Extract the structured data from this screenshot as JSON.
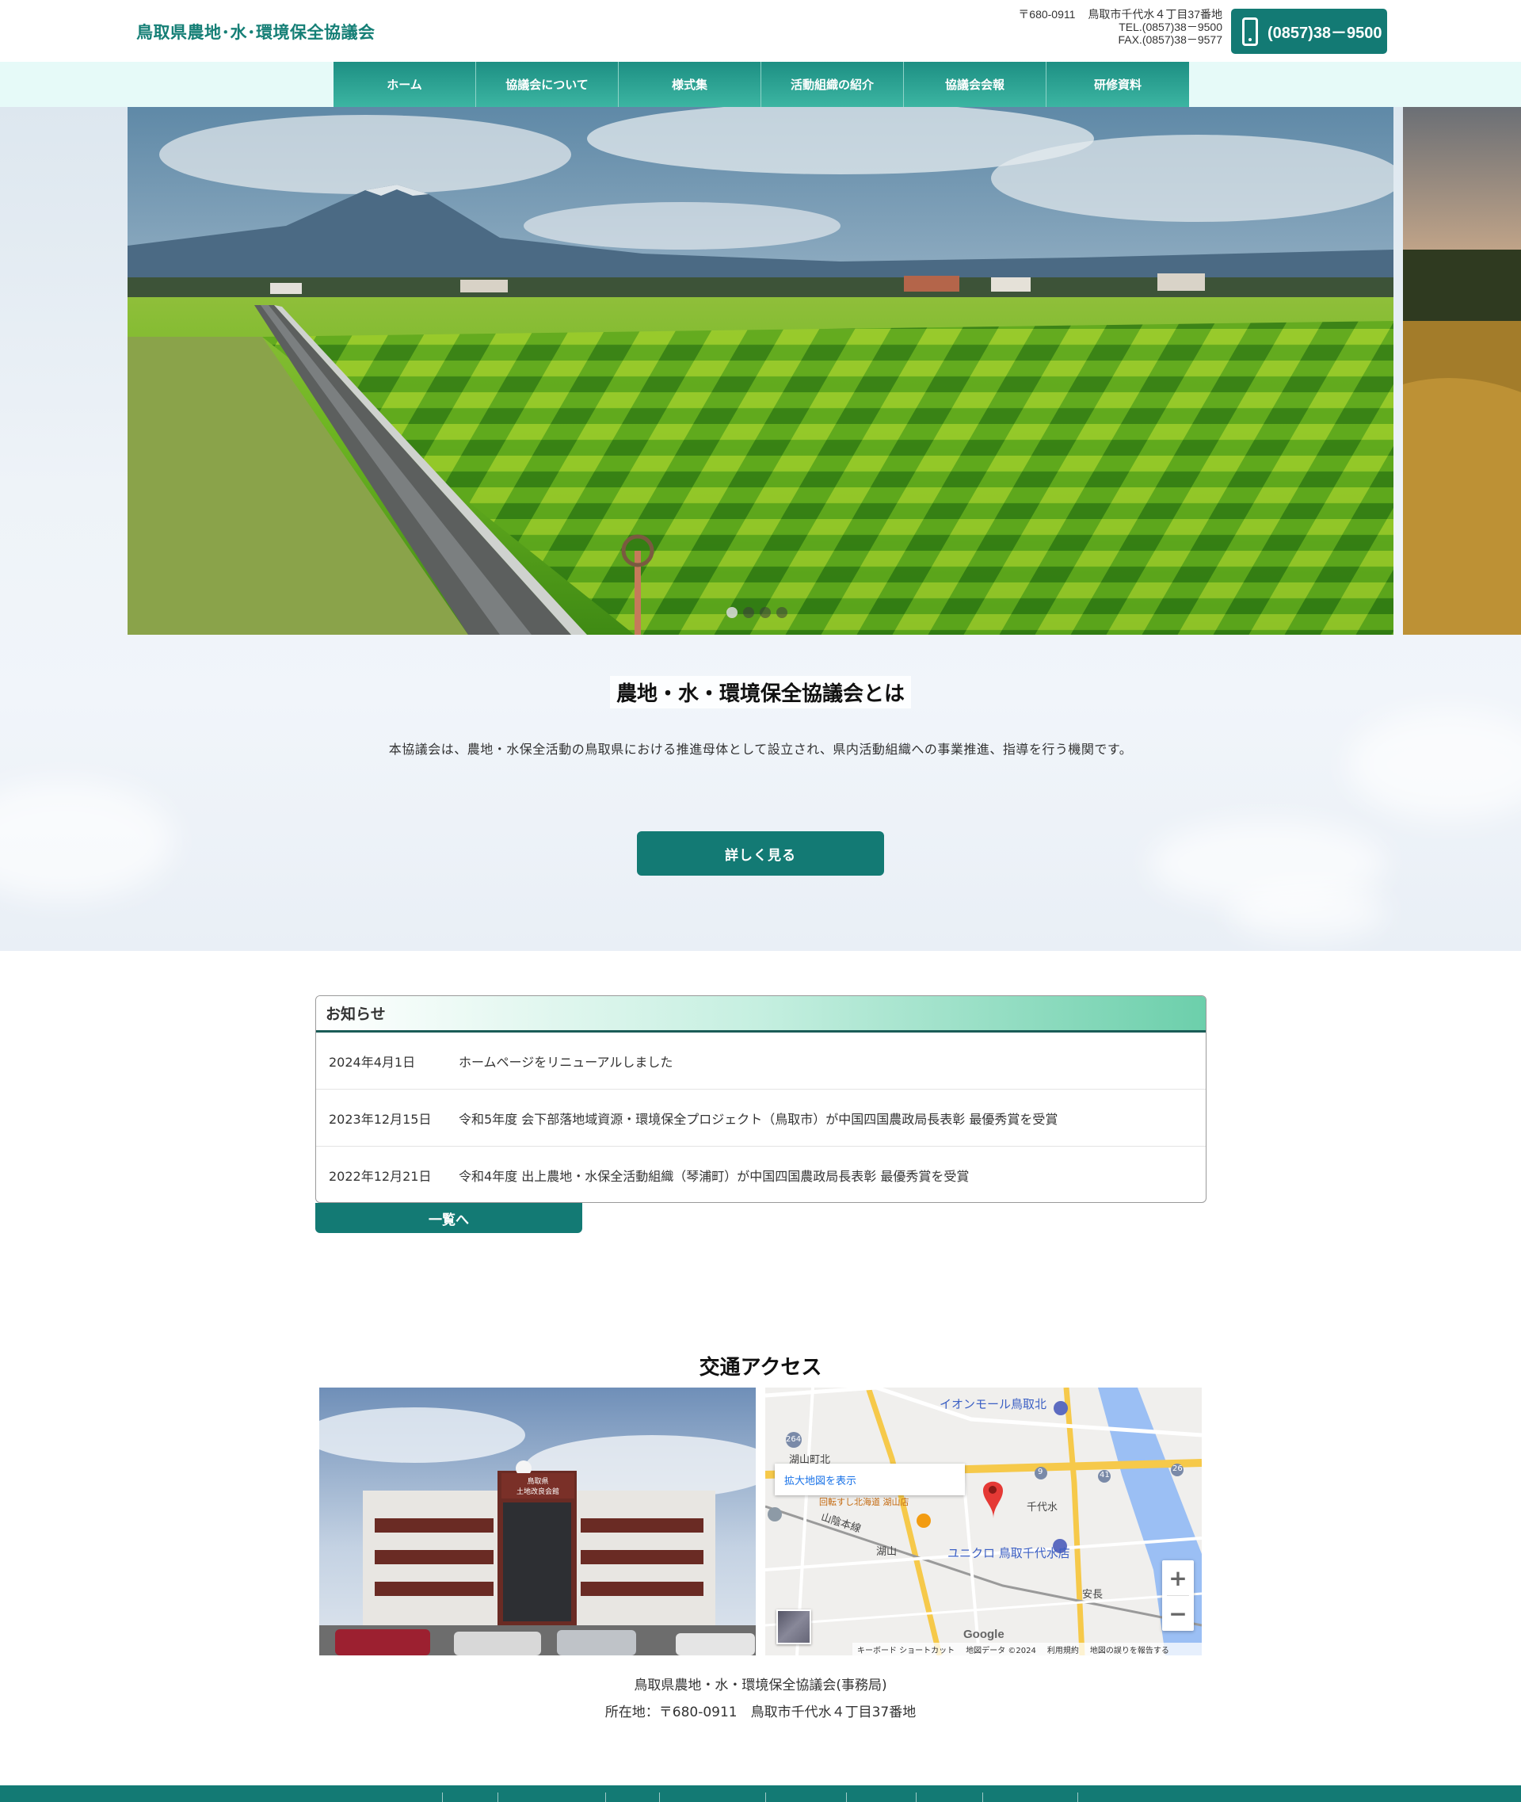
{
  "header": {
    "site_title": "鳥取県農地･水･環境保全協議会",
    "postal": "〒680-0911",
    "address": "鳥取市千代水４丁目37番地",
    "tel": "TEL.(0857)38－9500",
    "fax": "FAX.(0857)38－9577",
    "phone_button": "(0857)38－9500",
    "phone_icon": "smartphone-icon"
  },
  "nav": {
    "items": [
      {
        "label": "ホーム"
      },
      {
        "label": "協議会について"
      },
      {
        "label": "様式集"
      },
      {
        "label": "活動組織の紹介"
      },
      {
        "label": "協議会会報"
      },
      {
        "label": "研修資料"
      }
    ]
  },
  "slider": {
    "slide_count": 4,
    "active_index": 0
  },
  "about": {
    "title": "農地・水・環境保全協議会とは",
    "text": "本協議会は、農地・水保全活動の鳥取県における推進母体として設立され、県内活動組織への事業推進、指導を行う機関です。",
    "more_button": "詳しく見る"
  },
  "news": {
    "heading": "お知らせ",
    "items": [
      {
        "date": "2024年4月1日",
        "title": "ホームページをリニューアルしました"
      },
      {
        "date": "2023年12月15日",
        "title": "令和5年度 会下部落地域資源・環境保全プロジェクト（鳥取市）が中国四国農政局長表彰 最優秀賞を受賞"
      },
      {
        "date": "2022年12月21日",
        "title": "令和4年度 出上農地・水保全活動組織（琴浦町）が中国四国農政局長表彰 最優秀賞を受賞"
      }
    ],
    "list_button": "一覧へ"
  },
  "access": {
    "title": "交通アクセス",
    "map": {
      "enlarge_link": "拡大地図を表示",
      "labels": {
        "aeon": "イオンモール鳥取北",
        "koyama_north": "湖山町北",
        "chiyomi": "千代水",
        "uniqlo": "ユニクロ 鳥取千代水店",
        "koyama": "湖山",
        "sanin_line": "山陰本線",
        "yasunaga": "安長",
        "shop": "回転すし北海道 湖山店",
        "r264": "264",
        "r9": "9",
        "r41": "41",
        "r26": "26"
      },
      "google": "Google",
      "footer": [
        "キーボード ショートカット",
        "地図データ ©2024",
        "利用規約",
        "地図の誤りを報告する"
      ],
      "zoom_in": "+",
      "zoom_out": "−",
      "marker_color": "#e53935"
    },
    "org": "鳥取県農地・水・環境保全協議会(事務局)",
    "address": "所在地：〒680-0911　鳥取市千代水４丁目37番地",
    "building_sign": "鳥取県 土地改良会館"
  },
  "colors": {
    "brand": "#137a74",
    "title_green": "#157f76",
    "nav_band": "#e6faf8"
  }
}
